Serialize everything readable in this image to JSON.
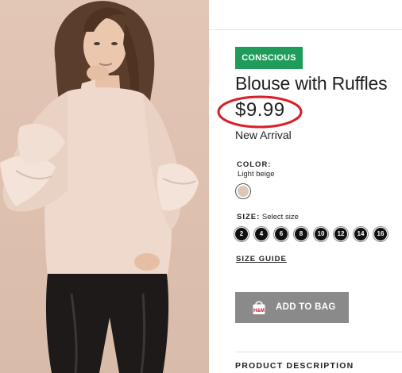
{
  "product": {
    "badge": "CONSCIOUS",
    "title": "Blouse with Ruffles",
    "price": "$9.99",
    "status": "New Arrival",
    "color": {
      "label": "COLOR:",
      "value": "Light beige",
      "swatch_hex": "#dcc6b7"
    },
    "size": {
      "label": "SIZE:",
      "hint": "Select size",
      "options": [
        "2",
        "4",
        "6",
        "8",
        "10",
        "12",
        "14",
        "16"
      ]
    },
    "size_guide": "SIZE GUIDE",
    "add_to_bag": "ADD TO BAG",
    "description_heading": "PRODUCT DESCRIPTION"
  },
  "colors": {
    "badge": "#1f9b5a",
    "button": "#8a8a8a",
    "price_highlight": "#d81f26"
  },
  "icons": {
    "add_to_bag": "shopping-bag-icon"
  }
}
